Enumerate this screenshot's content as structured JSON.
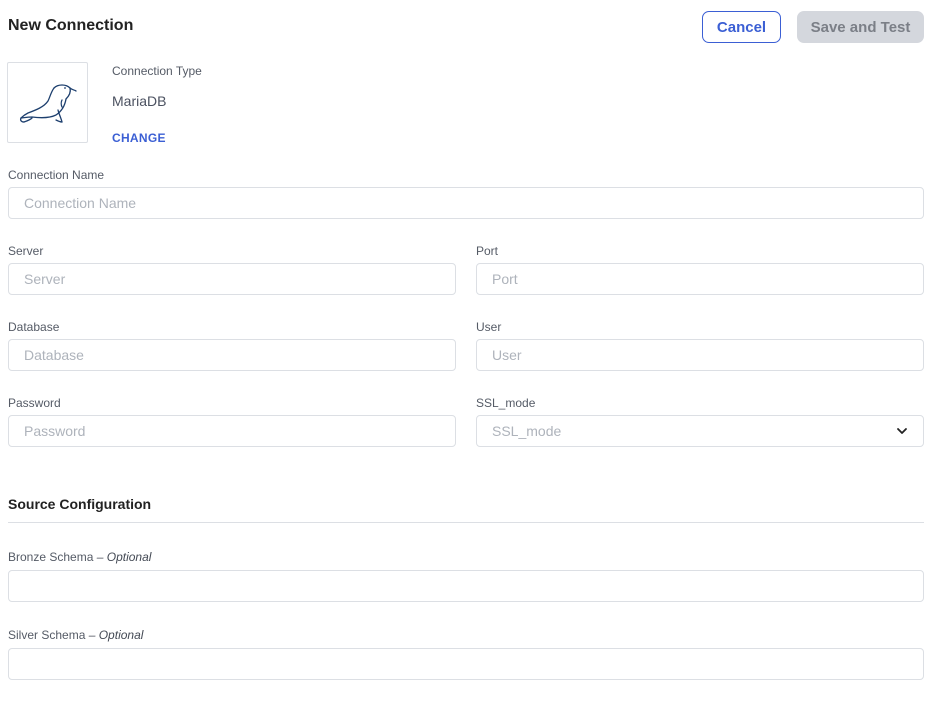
{
  "header": {
    "title": "New Connection",
    "cancel_label": "Cancel",
    "save_label": "Save and Test"
  },
  "connection_type": {
    "label": "Connection Type",
    "value": "MariaDB",
    "change_label": "CHANGE",
    "logo_icon": "mariadb-seal-icon"
  },
  "fields": {
    "connection_name": {
      "label": "Connection Name",
      "placeholder": "Connection Name",
      "value": ""
    },
    "server": {
      "label": "Server",
      "placeholder": "Server",
      "value": ""
    },
    "port": {
      "label": "Port",
      "placeholder": "Port",
      "value": ""
    },
    "database": {
      "label": "Database",
      "placeholder": "Database",
      "value": ""
    },
    "user": {
      "label": "User",
      "placeholder": "User",
      "value": ""
    },
    "password": {
      "label": "Password",
      "placeholder": "Password",
      "value": ""
    },
    "ssl_mode": {
      "label": "SSL_mode",
      "placeholder": "SSL_mode",
      "value": ""
    }
  },
  "source_configuration": {
    "title": "Source Configuration",
    "bronze_schema": {
      "label": "Bronze Schema",
      "optional": "– Optional",
      "value": ""
    },
    "silver_schema": {
      "label": "Silver Schema",
      "optional": "– Optional",
      "value": ""
    }
  },
  "colors": {
    "accent": "#3b5fd4",
    "border": "#dcdfe4",
    "placeholder": "#aeb3bb",
    "disabled_button_bg": "#d4d7dd"
  }
}
